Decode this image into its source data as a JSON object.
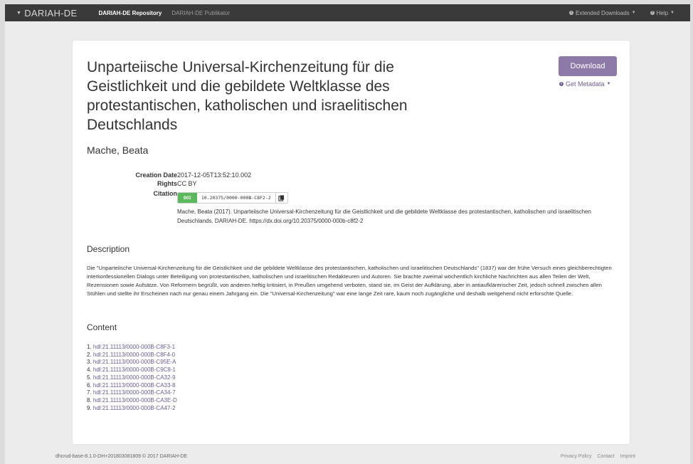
{
  "navbar": {
    "brand": "DARIAH-DE",
    "repository": "DARIAH-DE Repository",
    "publikator": "DARIAH-DE Publikator",
    "extended_downloads": "Extended Downloads",
    "help": "Help"
  },
  "record": {
    "title": "Unparteiische Universal-Kirchenzeitung für die Geistlichkeit und die gebildete Weltklasse des protestantischen, katholischen und israelitischen Deutschlands",
    "author": "Mache, Beata",
    "download_label": "Download",
    "get_metadata_label": "Get Metadata",
    "creation_date_label": "Creation Date",
    "creation_date": "2017-12-05T13:52:10.002",
    "rights_label": "Rights",
    "rights": "CC BY",
    "citation_label": "Citation",
    "doi_badge": "DOI",
    "doi": "10.20375/0000-000B-C8F2-2",
    "citation_text": "Mache, Beata (2017). Unparteiische Universal-Kirchenzeitung für die Geistlichkeit und die gebildete Weltklasse des protestantischen, katholischen und israelitischen Deutschlands. DARIAH-DE. https://dx.doi.org/10.20375/0000-000b-c8f2-2"
  },
  "description": {
    "heading": "Description",
    "text": "Die \"Unparteiische Universal-Kirchenzeitung für die Geistlichkeit und die gebildete Weltklasse des protestantischen, katholischen und israelitischen Deutschlands\" (1837) war der frühe Versuch eines gleichberechtigten interkonfessionellen Dialogs unter Beteiligung von protestantischen, katholischen und israelitischen Redakteuren und Autoren. Sie brachte zweimal wöchentlich kirchliche Nachrichten aus allen Teilen der Welt, Rezensionen sowie Aufsätze. Von Reformern begrüßt, von anderen heftig kritisiert, in Preußen umgehend verboten, stand sie, im Geist der Aufklärung, aber in antiaufklärerischer Zeit, jedoch schnell zwischen allen Stühlen und stellte ihr Erscheinen nach nur genau einem Jahrgang ein. Die \"Universal-Kirchenzeitung\" war eine lange Zeit rare, kaum noch zugängliche und deshalb weitgehend nicht erforschte Quelle."
  },
  "content": {
    "heading": "Content",
    "items": [
      {
        "num": "1.",
        "handle": "hdl:21.11113/0000-000B-C8F3-1"
      },
      {
        "num": "2.",
        "handle": "hdl:21.11113/0000-000B-C8F4-0"
      },
      {
        "num": "3.",
        "handle": "hdl:21.11113/0000-000B-C95E-A"
      },
      {
        "num": "4.",
        "handle": "hdl:21.11113/0000-000B-C9C8-1"
      },
      {
        "num": "5.",
        "handle": "hdl:21.11113/0000-000B-CA32-9"
      },
      {
        "num": "6.",
        "handle": "hdl:21.11113/0000-000B-CA33-8"
      },
      {
        "num": "7.",
        "handle": "hdl:21.11113/0000-000B-CA34-7"
      },
      {
        "num": "8.",
        "handle": "hdl:21.11113/0000-000B-CA3E-D"
      },
      {
        "num": "9.",
        "handle": "hdl:21.11113/0000-000B-CA47-2"
      }
    ]
  },
  "footer": {
    "version": "dhcrud-base-8.1.0-DH+201803081809 © 2017 DARIAH-DE",
    "privacy": "Privacy Policy",
    "contact": "Contact",
    "imprint": "Imprint"
  },
  "colors": {
    "navbar_bg": "#3a3a3a",
    "accent": "#8d7aa8",
    "link": "#6a5b93",
    "doi_green": "#5cb85c"
  }
}
